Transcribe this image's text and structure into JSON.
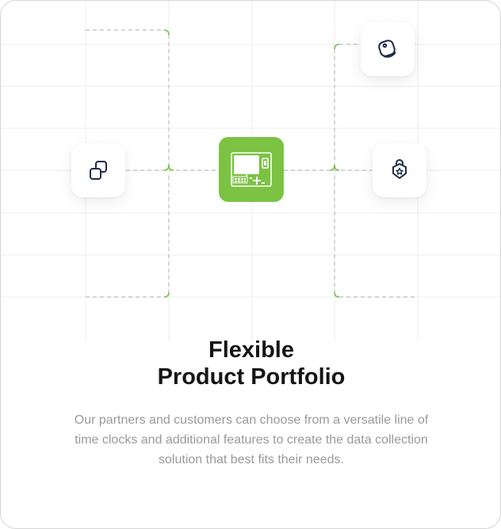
{
  "feature": {
    "title_line1": "Flexible",
    "title_line2": "Product Portfolio",
    "description": "Our partners and customers can choose from a versatile line of time clocks and additional features to create the data collection solution that best fits their needs."
  },
  "icons": {
    "left": "stacked-squares-icon",
    "top_right": "tag-icon",
    "right": "shield-badge-icon",
    "center": "time-clock-terminal-icon"
  },
  "colors": {
    "accent": "#7cc243",
    "icon_stroke": "#1e2a4a",
    "grid": "#ededed",
    "connector": "#bdbdbd",
    "title": "#151515",
    "description": "#9a9a9a"
  }
}
